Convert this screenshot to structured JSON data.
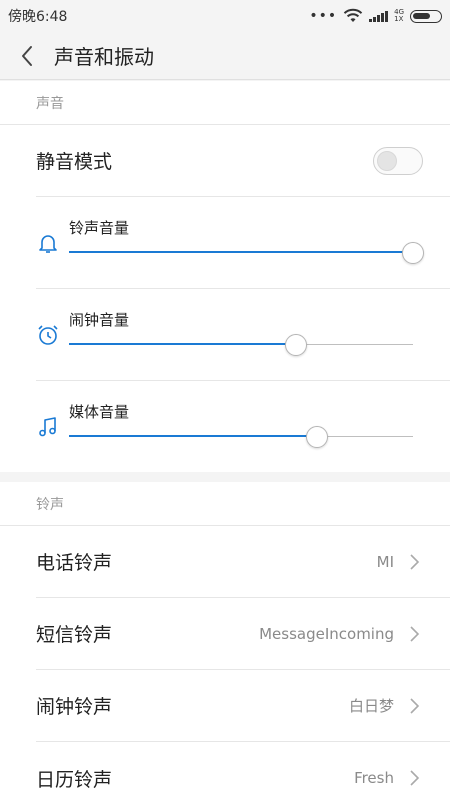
{
  "status_bar": {
    "time": "傍晚6:48",
    "dots": "•••",
    "network": "4G",
    "network_sub": "1X"
  },
  "header": {
    "title": "声音和振动"
  },
  "sound_section": {
    "title": "声音",
    "silent_mode": {
      "label": "静音模式",
      "enabled": false
    },
    "volumes": [
      {
        "label": "铃声音量",
        "icon": "bell-icon",
        "level": 1.0
      },
      {
        "label": "闹钟音量",
        "icon": "alarm-clock-icon",
        "level": 0.66
      },
      {
        "label": "媒体音量",
        "icon": "music-note-icon",
        "level": 0.72
      }
    ]
  },
  "ringtone_section": {
    "title": "铃声",
    "items": [
      {
        "label": "电话铃声",
        "value": "MI"
      },
      {
        "label": "短信铃声",
        "value": "MessageIncoming"
      },
      {
        "label": "闹钟铃声",
        "value": "白日梦"
      },
      {
        "label": "日历铃声",
        "value": "Fresh"
      }
    ]
  },
  "colors": {
    "accent": "#1a7ad4",
    "background": "#f4f4f4",
    "section_title": "#999999"
  }
}
